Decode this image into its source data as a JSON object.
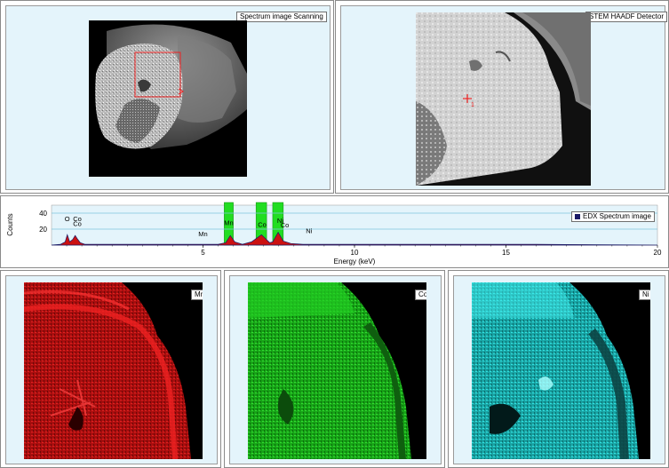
{
  "panels": {
    "top_left": {
      "label": "Spectrum image Scanning",
      "marker": "1"
    },
    "top_right": {
      "label": "STEM HAADF Detector",
      "marker": "1"
    },
    "map_mn": {
      "label": "Mn"
    },
    "map_co": {
      "label": "Co"
    },
    "map_ni": {
      "label": "Ni"
    }
  },
  "spectrum": {
    "legend": "EDX Spectrum image",
    "ylabel": "Counts",
    "xlabel": "Energy (keV)",
    "peak_labels": [
      "O",
      "Co",
      "Co",
      "Mn",
      "Mn",
      "Co",
      "Ni",
      "Co",
      "Ni"
    ]
  },
  "chart_data": {
    "type": "line",
    "title": "",
    "xlabel": "Energy (keV)",
    "ylabel": "Counts",
    "xlim": [
      0,
      20
    ],
    "ylim": [
      0,
      50
    ],
    "xticks": [
      5,
      10,
      15,
      20
    ],
    "yticks": [
      20,
      40
    ],
    "series": [
      {
        "name": "EDX Spectrum image",
        "x": [
          0.0,
          0.3,
          0.45,
          0.52,
          0.6,
          0.7,
          0.78,
          0.85,
          0.95,
          1.1,
          1.5,
          2.5,
          4.0,
          5.5,
          5.75,
          5.9,
          6.05,
          6.3,
          6.6,
          6.93,
          7.2,
          7.3,
          7.48,
          7.65,
          7.9,
          8.3,
          9.0,
          12.0,
          16.0,
          20.0
        ],
        "y": [
          0,
          1,
          4,
          13,
          4,
          7,
          12,
          8,
          3,
          1,
          1,
          1,
          1,
          1,
          3,
          12,
          4,
          1,
          4,
          13,
          3,
          4,
          16,
          5,
          2,
          1,
          1,
          1,
          1,
          0
        ]
      }
    ],
    "highlight_bands_keV": [
      {
        "from": 5.7,
        "to": 6.0
      },
      {
        "from": 6.75,
        "to": 7.1
      },
      {
        "from": 7.3,
        "to": 7.65
      }
    ],
    "colors": {
      "spectrum_fill": "#cc1111",
      "spectrum_outline": "#1a1a66",
      "band_fill": "#22dd22",
      "gridline": "#7fc4dd",
      "legend_marker": "#1a1a66"
    }
  },
  "colors": {
    "panel_bg": "#e4f4fb",
    "mn_map": "#dd1111",
    "co_map": "#22cc22",
    "ni_map": "#22dddd",
    "roi_box": "#ee2222"
  }
}
